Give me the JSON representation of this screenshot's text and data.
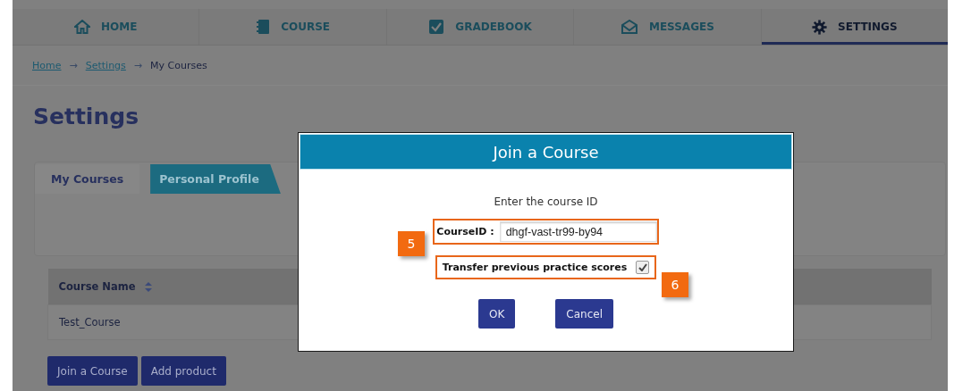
{
  "nav_tabs": [
    {
      "label": "HOME",
      "selected": false
    },
    {
      "label": "COURSE",
      "selected": false
    },
    {
      "label": "GRADEBOOK",
      "selected": false
    },
    {
      "label": "MESSAGES",
      "selected": false
    },
    {
      "label": "SETTINGS",
      "selected": true
    }
  ],
  "breadcrumb": [
    {
      "kind": "link",
      "text": "Home"
    },
    {
      "kind": "separator",
      "text": "→"
    },
    {
      "kind": "link",
      "text": "Settings"
    },
    {
      "kind": "separator",
      "text": "→"
    },
    {
      "kind": "current",
      "text": "My Courses"
    }
  ],
  "page_title": "Settings",
  "tabs": [
    {
      "label": "My Courses",
      "selected": true
    },
    {
      "label": "Personal Profile",
      "selected": false
    }
  ],
  "table": {
    "columns": [
      {
        "label": "Course Name"
      }
    ],
    "rows": [
      [
        "Test_Course"
      ]
    ]
  },
  "buttons": [
    "Join a Course",
    "Add product"
  ],
  "dialog": {
    "title": "Join a Course",
    "prompt": "Enter the course ID",
    "field": {
      "label": "CourseID :",
      "value": "dhgf-vast-tr99-by94"
    },
    "checkbox": {
      "label": "Transfer previous practice scores",
      "checked": true
    },
    "buttons": [
      "OK",
      "Cancel"
    ],
    "callouts": [
      "5",
      "6"
    ]
  }
}
